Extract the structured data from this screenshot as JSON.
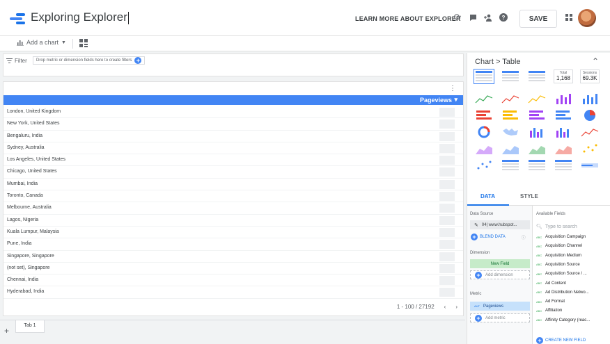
{
  "header": {
    "title": "Exploring Explorer",
    "learn_more": "LEARN MORE ABOUT EXPLORER",
    "save_label": "SAVE"
  },
  "toolbar": {
    "add_chart_label": "Add a chart"
  },
  "filter": {
    "label": "Filter",
    "placeholder": "Drop metric or dimension fields here to create filters"
  },
  "table": {
    "column_header": "Pageviews",
    "rows": [
      "London, United Kingdom",
      "New York, United States",
      "Bengaluru, India",
      "Sydney, Australia",
      "Los Angeles, United States",
      "Chicago, United States",
      "Mumbai, India",
      "Toronto, Canada",
      "Melbourne, Australia",
      "Lagos, Nigeria",
      "Kuala Lumpur, Malaysia",
      "Pune, India",
      "Singapore, Singapore",
      "(not set), Singapore",
      "Chennai, India",
      "Hyderabad, India"
    ],
    "pagination": "1 - 100 / 27192"
  },
  "tabs": {
    "tab1_label": "Tab 1"
  },
  "panel": {
    "breadcrumb": "Chart > Table",
    "kpi1_label": "Total",
    "kpi1_value": "1,168",
    "kpi2_label": "Sessions",
    "kpi2_value": "69.3K",
    "tab_data": "DATA",
    "tab_style": "STYLE",
    "data_source_label": "Data Source",
    "data_source_value": "04| www.hubspot...",
    "blend_label": "BLEND DATA",
    "dimension_label": "Dimension",
    "dimension_value": "New Field",
    "add_dimension": "Add dimension",
    "metric_label": "Metric",
    "metric_value": "Pageviews",
    "metric_type": "AUT",
    "add_metric": "Add metric",
    "available_fields_label": "Available Fields",
    "search_placeholder": "Type to search",
    "fields": [
      "Acquisition Campaign",
      "Acquisition Channel",
      "Acquisition Medium",
      "Acquisition Source",
      "Acquisition Source / ...",
      "Ad Content",
      "Ad Distribution Netwo...",
      "Ad Format",
      "Affiliation",
      "Affinity Category (reac..."
    ],
    "create_field": "CREATE NEW FIELD"
  },
  "colors": {
    "accent": "#4285f4",
    "link": "#1a73e8",
    "dimension_chip": "#c6ebc9",
    "metric_chip": "#c6e1fb"
  }
}
